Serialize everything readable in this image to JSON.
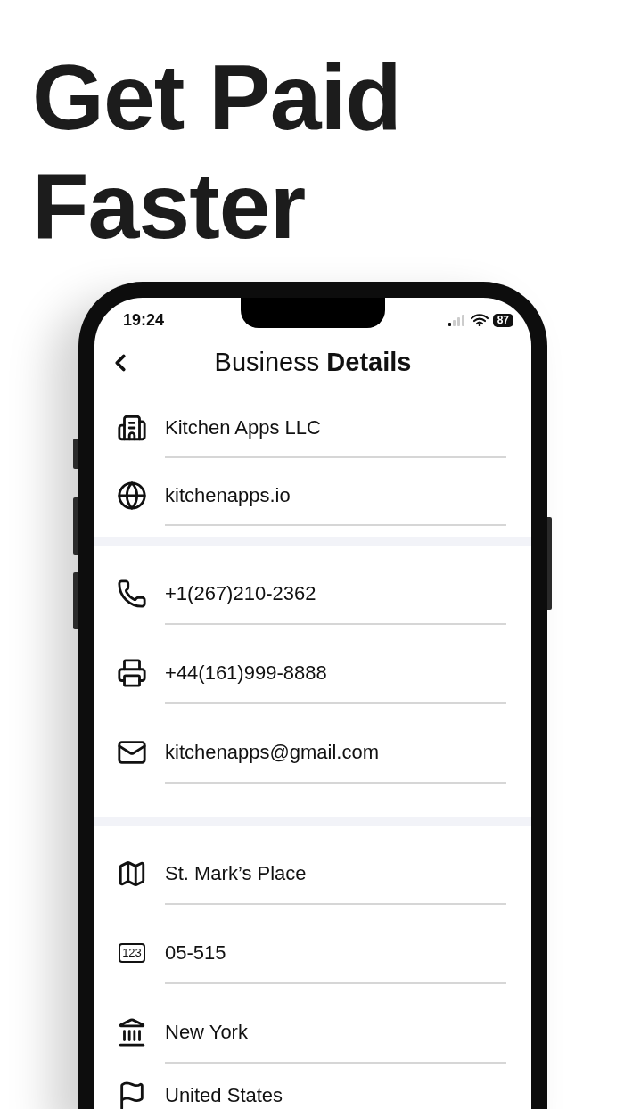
{
  "headline": "Get Paid Faster",
  "status_bar": {
    "time": "19:24",
    "battery": "87"
  },
  "nav": {
    "title": "Business **Details**"
  },
  "sections": [
    {
      "fields": [
        {
          "value": "Kitchen Apps LLC"
        },
        {
          "value": "kitchenapps.io"
        }
      ]
    },
    {
      "fields": [
        {
          "value": "+1(267)210-2362"
        },
        {
          "value": "+44(161)999-8888"
        },
        {
          "value": "kitchenapps@gmail.com"
        }
      ]
    },
    {
      "fields": [
        {
          "value": "St. Mark’s Place"
        },
        {
          "value": "05-515",
          "icon_text": "123"
        },
        {
          "value": "New York"
        },
        {
          "value": "United States"
        }
      ]
    }
  ]
}
